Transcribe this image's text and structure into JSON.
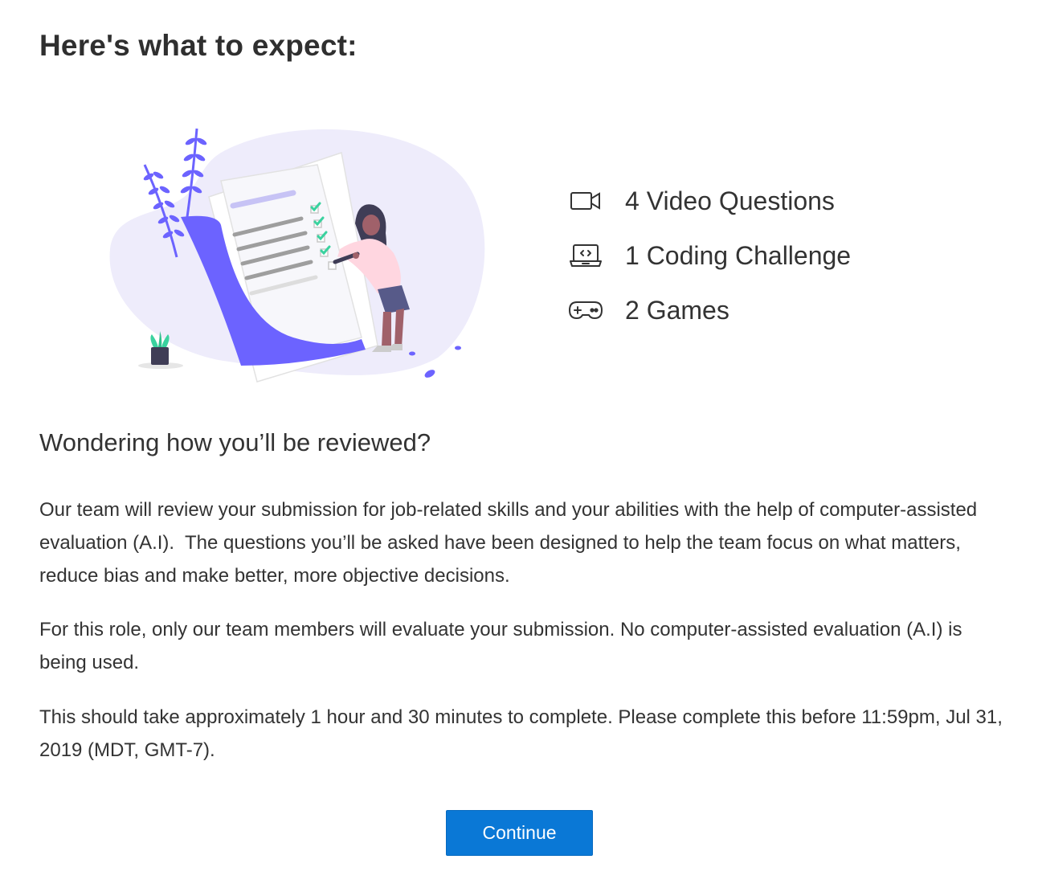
{
  "page": {
    "title": "Here's what to expect:"
  },
  "expect_items": [
    {
      "icon": "video-camera-icon",
      "label": "4 Video Questions"
    },
    {
      "icon": "laptop-code-icon",
      "label": "1 Coding Challenge"
    },
    {
      "icon": "gamepad-icon",
      "label": "2 Games"
    }
  ],
  "review": {
    "heading": "Wondering how you’ll be reviewed?",
    "paragraph_1": "Our team will review your submission for job-related skills and your abilities with the help of computer-assisted evaluation (A.I).  The questions you’ll be asked have been designed to help the team focus on what matters, reduce bias and make better, more objective decisions.",
    "paragraph_2": "For this role, only our team members will evaluate your submission. No computer-assisted evaluation (A.I) is being used.",
    "paragraph_3": "This should take approximately 1 hour and 30 minutes to complete. Please complete this before 11:59pm, Jul 31, 2019 (MDT, GMT-7)."
  },
  "actions": {
    "continue_label": "Continue"
  },
  "colors": {
    "accent": "#0a78d6",
    "illustration_primary": "#6c63ff",
    "illustration_bg": "#eeecfb",
    "check_green": "#3ad29f"
  }
}
